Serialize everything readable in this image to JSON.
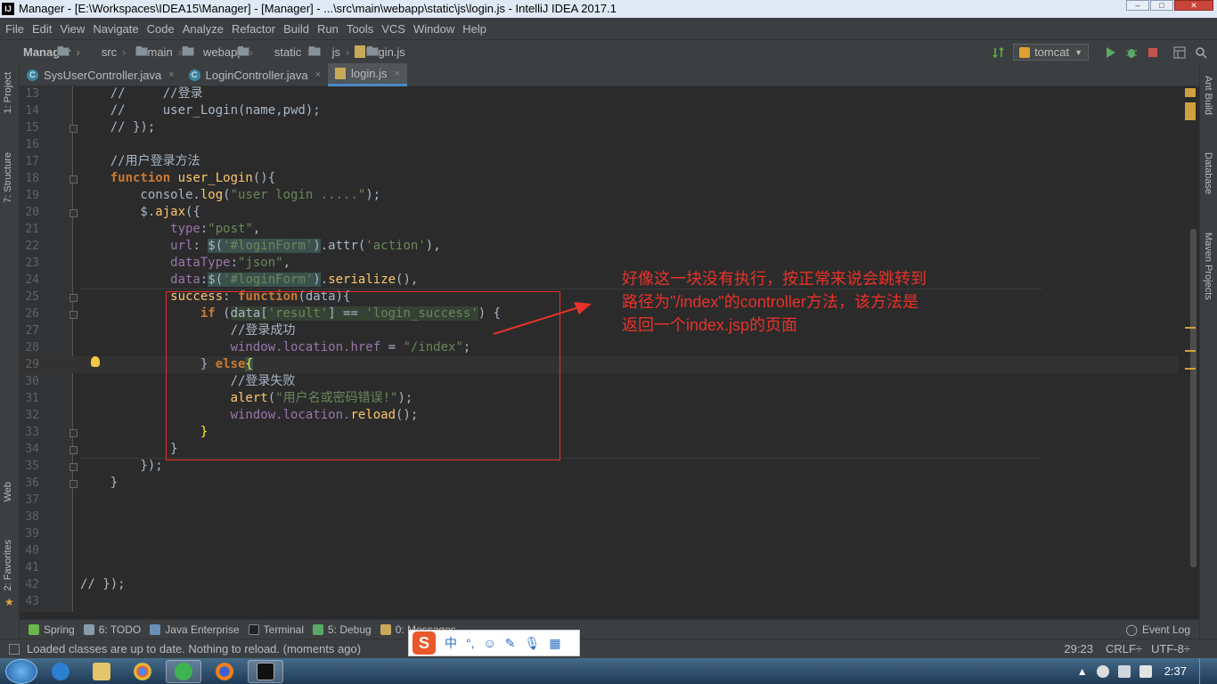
{
  "titlebar": {
    "title": "Manager - [E:\\Workspaces\\IDEA15\\Manager] - [Manager] - ...\\src\\main\\webapp\\static\\js\\login.js - IntelliJ IDEA 2017.1",
    "app_icon": "IJ"
  },
  "menu": [
    "File",
    "Edit",
    "View",
    "Navigate",
    "Code",
    "Analyze",
    "Refactor",
    "Build",
    "Run",
    "Tools",
    "VCS",
    "Window",
    "Help"
  ],
  "breadcrumbs": [
    "Manager",
    "src",
    "main",
    "webapp",
    "static",
    "js",
    "login.js"
  ],
  "run_config": "tomcat",
  "left_tabs": {
    "project": "1: Project",
    "structure": "7: Structure",
    "web": "Web",
    "favorites": "2: Favorites"
  },
  "right_tabs": {
    "ant": "Ant Build",
    "database": "Database",
    "maven": "Maven Projects"
  },
  "tabs": [
    {
      "label": "SysUserController.java",
      "close": "×"
    },
    {
      "label": "LoginController.java",
      "close": "×"
    },
    {
      "label": "login.js",
      "close": "×"
    }
  ],
  "code_lines": [
    {
      "n": "13"
    },
    {
      "n": "14"
    },
    {
      "n": "15"
    },
    {
      "n": "16"
    },
    {
      "n": "17"
    },
    {
      "n": "18"
    },
    {
      "n": "19"
    },
    {
      "n": "20"
    },
    {
      "n": "21"
    },
    {
      "n": "22"
    },
    {
      "n": "23"
    },
    {
      "n": "24"
    },
    {
      "n": "25"
    },
    {
      "n": "26"
    },
    {
      "n": "27"
    },
    {
      "n": "28"
    },
    {
      "n": "29"
    },
    {
      "n": "30"
    },
    {
      "n": "31"
    },
    {
      "n": "32"
    },
    {
      "n": "33"
    },
    {
      "n": "34"
    },
    {
      "n": "35"
    },
    {
      "n": "36"
    },
    {
      "n": "37"
    },
    {
      "n": "38"
    },
    {
      "n": "39"
    },
    {
      "n": "40"
    },
    {
      "n": "41"
    },
    {
      "n": "42"
    },
    {
      "n": "43"
    }
  ],
  "code": {
    "l13_a": "    //     ",
    "l13_b": "//登录",
    "l14": "    //     user_Login(name,pwd);",
    "l15": "    // });",
    "l17": "    //用户登录方法",
    "l18_kw": "function ",
    "l18_fn": "user_Login",
    "l18_rest": "(){",
    "l19_a": "        console.",
    "l19_fn": "log",
    "l19_b": "(",
    "l19_str": "\"user login .....\"",
    "l19_c": ");",
    "l20_a": "        $.",
    "l20_fn": "ajax",
    "l20_b": "({",
    "l21_p": "            type",
    "l21_c": ":",
    "l21_s": "\"post\"",
    "l21_e": ",",
    "l22_p": "            url",
    "l22_c": ": ",
    "l22_h": "$(",
    "l22_s": "'#loginForm'",
    "l22_h2": ")",
    ".l22_r": "",
    "l22_r": ".attr(",
    "l22_s2": "'action'",
    "l22_e": "),",
    "l23_p": "            dataType",
    "l23_c": ":",
    "l23_s": "\"json\"",
    "l23_e": ",",
    "l24_p": "            data",
    "l24_c": ":",
    "l24_h": "$(",
    "l24_s": "'#loginForm'",
    "l24_h2": ")",
    "l24_r": ".",
    "l24_fn": "serialize",
    "l24_e": "(),",
    "l25_p": "            success",
    "l25_c": ": ",
    "l25_kw": "function",
    "l25_e": "(data){",
    "l26_kw": "                if ",
    "l26_a": "(",
    "l26_h": "data[",
    "l26_s": "'result'",
    "l26_m": "] == ",
    "l26_s2": "'login_success'",
    "l26_e": ") {",
    "l27": "                    //登录成功",
    "l28_p": "                    window.location.",
    "l28_q": "href",
    "l28_m": " = ",
    "l28_s": "\"/index\"",
    "l28_e": ";",
    "l29_a": "                } ",
    "l29_kw": "else",
    "l29_b": "{",
    "l30": "                    //登录失败",
    "l31_fn": "                    alert",
    "l31_a": "(",
    "l31_s": "\"用户名或密码错误!\"",
    "l31_e": ");",
    "l32_a": "                    window.location.",
    "l32_fn": "reload",
    "l32_e": "();",
    "l33": "                }",
    "l34": "            }",
    "l35": "        });",
    "l36": "    }",
    "l42": "// });"
  },
  "annotation": {
    "line1": "好像这一块没有执行，按正常来说会跳转到",
    "line2": "路径为\"/index\"的controller方法，该方法是",
    "line3": "返回一个index.jsp的页面"
  },
  "tool_windows": [
    {
      "label": "Spring"
    },
    {
      "label": "6: TODO"
    },
    {
      "label": "Java Enterprise"
    },
    {
      "label": "Terminal"
    },
    {
      "label": "5: Debug"
    },
    {
      "label": "0: Messages"
    }
  ],
  "event_log": "Event Log",
  "status": {
    "message": "Loaded classes are up to date. Nothing to reload. (moments ago)",
    "position": "29:23",
    "line_sep": "CRLF÷",
    "encoding": "UTF-8÷"
  },
  "ime": {
    "logo": "S",
    "mode": "中",
    "punct": "°,"
  },
  "clock": "2:37",
  "colors": {
    "annotation": "#e8322a",
    "accent": "#4a88c7",
    "keyword": "#cc7832",
    "string": "#6a8759"
  }
}
